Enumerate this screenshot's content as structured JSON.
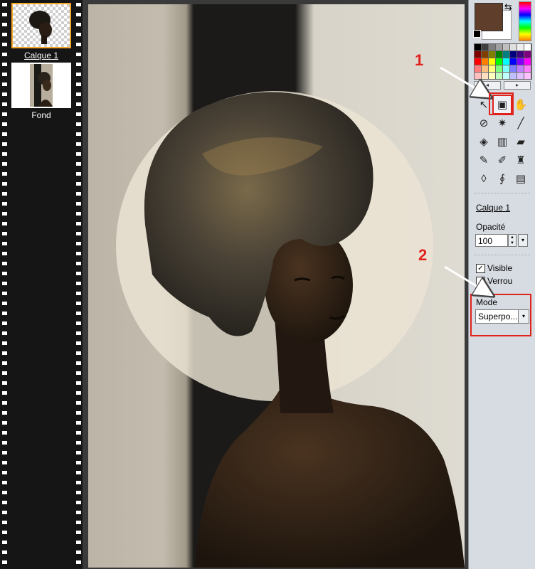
{
  "layers": [
    {
      "name": "Calque 1",
      "selected": true
    },
    {
      "name": "Fond",
      "selected": false
    }
  ],
  "colors": {
    "foreground": "#5f3f2c",
    "background": "#ffffff",
    "highlight": "#e0221d",
    "selected_layer_border": "#f3a72b"
  },
  "palette": [
    "#000000",
    "#3f3f3f",
    "#7f7f7f",
    "#9f9f9f",
    "#bfbfbf",
    "#dfdfdf",
    "#efefef",
    "#ffffff",
    "#7f0000",
    "#7f3f00",
    "#7f7f00",
    "#007f00",
    "#007f7f",
    "#00007f",
    "#3f007f",
    "#7f007f",
    "#ff0000",
    "#ff7f00",
    "#ffff00",
    "#00ff00",
    "#00ffff",
    "#0000ff",
    "#7f00ff",
    "#ff00ff",
    "#ff7f7f",
    "#ffbf7f",
    "#ffff7f",
    "#7fff7f",
    "#7fffff",
    "#7f7fff",
    "#bf7fff",
    "#ff7fff",
    "#ffbfbf",
    "#ffdfbf",
    "#ffffbf",
    "#bfffbf",
    "#bfffff",
    "#bfbfff",
    "#dfbfff",
    "#ffbfff"
  ],
  "tools": [
    {
      "name": "select-tool",
      "glyph": "↖",
      "highlight": false
    },
    {
      "name": "layer-properties-tool",
      "glyph": "▣",
      "highlight": true
    },
    {
      "name": "hand-tool",
      "glyph": "✋",
      "highlight": false
    },
    {
      "name": "eyedropper-tool",
      "glyph": "⊘",
      "highlight": false
    },
    {
      "name": "magic-wand-tool",
      "glyph": "✷",
      "highlight": false
    },
    {
      "name": "line-tool",
      "glyph": "╱",
      "highlight": false
    },
    {
      "name": "paint-bucket-tool",
      "glyph": "◈",
      "highlight": false
    },
    {
      "name": "spray-can-tool",
      "glyph": "▥",
      "highlight": false
    },
    {
      "name": "eraser-tool",
      "glyph": "▰",
      "highlight": false
    },
    {
      "name": "brush-tool",
      "glyph": "✎",
      "highlight": false
    },
    {
      "name": "add-brush-tool",
      "glyph": "✐",
      "highlight": false
    },
    {
      "name": "stamp-tool",
      "glyph": "♜",
      "highlight": false
    },
    {
      "name": "drop-tool",
      "glyph": "◊",
      "highlight": false
    },
    {
      "name": "smudge-tool",
      "glyph": "∮",
      "highlight": false
    },
    {
      "name": "portrait-tool",
      "glyph": "▤",
      "highlight": false
    }
  ],
  "properties": {
    "layer_name": "Calque 1",
    "opacity_label": "Opacité",
    "opacity_value": "100",
    "visible_label": "Visible",
    "visible_checked": true,
    "lock_label": "Verrou",
    "lock_checked": false,
    "mode_label": "Mode",
    "mode_value": "Superpo..."
  },
  "annotations": {
    "step1": "1",
    "step2": "2"
  }
}
